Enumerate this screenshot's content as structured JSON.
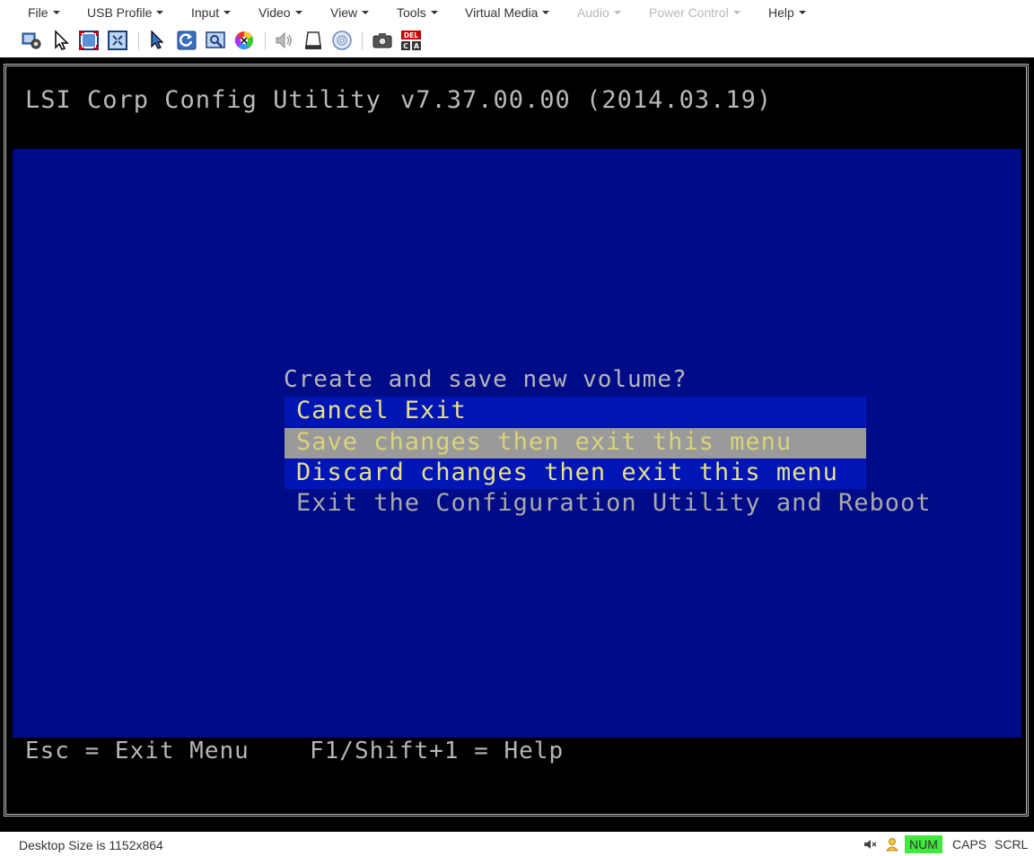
{
  "menubar": {
    "items": [
      {
        "label": "File",
        "enabled": true
      },
      {
        "label": "USB Profile",
        "enabled": true
      },
      {
        "label": "Input",
        "enabled": true
      },
      {
        "label": "Video",
        "enabled": true
      },
      {
        "label": "View",
        "enabled": true
      },
      {
        "label": "Tools",
        "enabled": true
      },
      {
        "label": "Virtual Media",
        "enabled": true
      },
      {
        "label": "Audio",
        "enabled": false
      },
      {
        "label": "Power Control",
        "enabled": false
      },
      {
        "label": "Help",
        "enabled": true
      }
    ]
  },
  "toolbar": {
    "icons": [
      "settings-icon",
      "pointer-icon",
      "fullscreen-icon",
      "fit-window-icon",
      "dual-pointer-icon",
      "refresh-icon",
      "zoom-icon",
      "color-wheel-icon",
      "speaker-icon",
      "usb-drive-icon",
      "cd-disc-icon",
      "camera-icon",
      "ctrl-alt-del-icon"
    ],
    "cad_label_top": "DEL",
    "cad_label_left": "C",
    "cad_label_right": "A"
  },
  "bios": {
    "title": "LSI Corp Config Utility",
    "version": "v7.37.00.00 (2014.03.19)",
    "dialog_prompt": "Create and save new volume?",
    "options": [
      {
        "label": "Cancel Exit"
      },
      {
        "label": "Save changes then exit this menu",
        "selected": true
      },
      {
        "label": "Discard changes then exit this menu"
      },
      {
        "label": "Exit the Configuration Utility and Reboot"
      }
    ],
    "footer_left": "Esc = Exit Menu",
    "footer_right": "F1/Shift+1 = Help",
    "colors": {
      "background": "#000c87",
      "highlight": "#9a9a9a",
      "option_bg": "#0015b5",
      "option_text": "#e6e08a"
    }
  },
  "statusbar": {
    "desktop_size": "Desktop Size is 1152x864",
    "num": "NUM",
    "caps": "CAPS",
    "scrl": "SCRL",
    "num_color": "#41e83e"
  }
}
